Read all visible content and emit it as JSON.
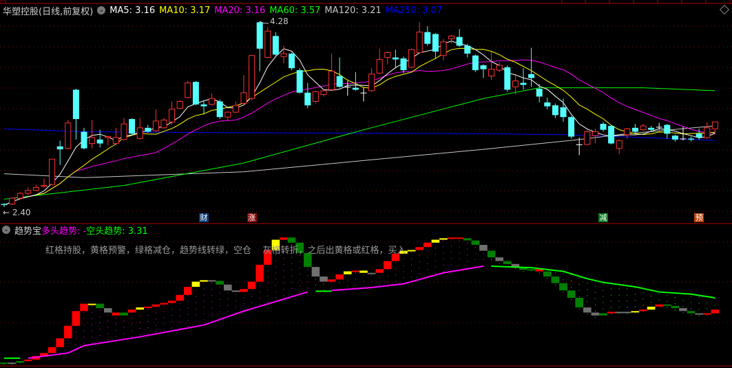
{
  "header": {
    "title": "华塑控股(日线,前复权)",
    "ma": [
      {
        "label": "MA5: 3.16",
        "color": "#ffffff"
      },
      {
        "label": "MA10: 3.17",
        "color": "#ffff00"
      },
      {
        "label": "MA20: 3.16",
        "color": "#ff00ff"
      },
      {
        "label": "MA60: 3.57",
        "color": "#00ff00"
      },
      {
        "label": "MA120: 3.21",
        "color": "#c8c8c8"
      },
      {
        "label": "MA250: 3.07",
        "color": "#0000ff"
      }
    ]
  },
  "indicator": {
    "name": "趋势宝",
    "bull_label": "多头趋势: -",
    "bear_label": "空头趋势: 3.31",
    "note": "红格持股，黄格预警，绿格减仓，趋势线转绿，空仓    灰格转折，之后出黄格或红格，买入"
  },
  "markers": [
    {
      "text": "财",
      "index": 25,
      "color": "#0a3d7a"
    },
    {
      "text": "涨",
      "index": 31,
      "color": "#8a0a0a"
    },
    {
      "text": "减",
      "index": 75,
      "color": "#0a7a1e"
    },
    {
      "text": "预",
      "index": 87,
      "color": "#b8420a"
    }
  ],
  "chart_data": [
    {
      "type": "candlestick",
      "ohlc": [
        [
          2.41,
          2.42,
          2.38,
          2.4
        ],
        [
          2.41,
          2.48,
          2.4,
          2.47
        ],
        [
          2.47,
          2.53,
          2.46,
          2.52
        ],
        [
          2.52,
          2.58,
          2.5,
          2.55
        ],
        [
          2.55,
          2.61,
          2.54,
          2.58
        ],
        [
          2.59,
          2.67,
          2.58,
          2.6
        ],
        [
          2.61,
          2.87,
          2.6,
          2.87
        ],
        [
          3.0,
          3.06,
          2.81,
          2.97
        ],
        [
          2.98,
          3.27,
          2.97,
          3.24
        ],
        [
          3.58,
          3.59,
          3.07,
          3.28
        ],
        [
          3.15,
          3.19,
          2.97,
          2.98
        ],
        [
          3.03,
          3.27,
          2.98,
          3.09
        ],
        [
          3.07,
          3.17,
          2.99,
          3.03
        ],
        [
          3.09,
          3.11,
          3.01,
          3.1
        ],
        [
          3.03,
          3.19,
          3.01,
          3.09
        ],
        [
          3.07,
          3.29,
          3.06,
          3.23
        ],
        [
          3.28,
          3.29,
          3.12,
          3.13
        ],
        [
          3.08,
          3.29,
          3.07,
          3.19
        ],
        [
          3.19,
          3.22,
          3.14,
          3.15
        ],
        [
          3.16,
          3.38,
          3.15,
          3.26
        ],
        [
          3.19,
          3.29,
          3.18,
          3.27
        ],
        [
          3.25,
          3.46,
          3.22,
          3.38
        ],
        [
          3.39,
          3.47,
          3.38,
          3.46
        ],
        [
          3.5,
          3.67,
          3.49,
          3.65
        ],
        [
          3.66,
          3.67,
          3.42,
          3.43
        ],
        [
          3.43,
          3.46,
          3.33,
          3.41
        ],
        [
          3.43,
          3.54,
          3.42,
          3.49
        ],
        [
          3.46,
          3.48,
          3.28,
          3.3
        ],
        [
          3.3,
          3.36,
          3.26,
          3.35
        ],
        [
          3.35,
          3.46,
          3.34,
          3.42
        ],
        [
          3.44,
          3.73,
          3.42,
          3.55
        ],
        [
          3.49,
          3.94,
          3.47,
          3.93
        ],
        [
          4.27,
          4.28,
          3.77,
          4.0
        ],
        [
          3.91,
          4.22,
          3.9,
          4.18
        ],
        [
          4.13,
          4.17,
          3.93,
          3.94
        ],
        [
          3.92,
          4.03,
          3.85,
          3.95
        ],
        [
          3.95,
          3.96,
          3.78,
          3.8
        ],
        [
          3.78,
          3.8,
          3.54,
          3.55
        ],
        [
          3.55,
          3.65,
          3.39,
          3.42
        ],
        [
          3.46,
          3.57,
          3.44,
          3.56
        ],
        [
          3.53,
          3.58,
          3.51,
          3.57
        ],
        [
          3.58,
          3.95,
          3.57,
          3.77
        ],
        [
          3.72,
          3.91,
          3.6,
          3.61
        ],
        [
          3.61,
          3.67,
          3.52,
          3.61
        ],
        [
          3.6,
          3.76,
          3.57,
          3.58
        ],
        [
          3.55,
          3.6,
          3.46,
          3.55
        ],
        [
          3.57,
          3.8,
          3.56,
          3.74
        ],
        [
          3.75,
          4.0,
          3.74,
          3.89
        ],
        [
          3.91,
          3.97,
          3.84,
          3.96
        ],
        [
          3.91,
          3.99,
          3.8,
          3.89
        ],
        [
          3.9,
          3.92,
          3.75,
          3.78
        ],
        [
          3.81,
          4.0,
          3.8,
          3.99
        ],
        [
          3.96,
          4.27,
          3.95,
          4.17
        ],
        [
          4.17,
          4.23,
          4.03,
          4.05
        ],
        [
          4.15,
          4.16,
          3.9,
          3.97
        ],
        [
          3.93,
          4.1,
          3.88,
          4.07
        ],
        [
          4.1,
          4.14,
          4.05,
          4.13
        ],
        [
          4.12,
          4.2,
          4.02,
          4.03
        ],
        [
          4.03,
          4.05,
          3.91,
          3.95
        ],
        [
          3.93,
          3.94,
          3.76,
          3.78
        ],
        [
          3.83,
          3.84,
          3.7,
          3.79
        ],
        [
          3.72,
          3.97,
          3.68,
          3.79
        ],
        [
          3.78,
          3.86,
          3.76,
          3.83
        ],
        [
          3.81,
          3.83,
          3.56,
          3.58
        ],
        [
          3.61,
          3.73,
          3.53,
          3.67
        ],
        [
          3.65,
          3.8,
          3.58,
          3.63
        ],
        [
          3.74,
          4.01,
          3.61,
          3.7
        ],
        [
          3.59,
          3.64,
          3.45,
          3.51
        ],
        [
          3.45,
          3.5,
          3.38,
          3.41
        ],
        [
          3.42,
          3.44,
          3.29,
          3.32
        ],
        [
          3.4,
          3.49,
          3.25,
          3.3
        ],
        [
          3.3,
          3.31,
          3.08,
          3.1
        ],
        [
          3.02,
          3.09,
          2.91,
          3.02
        ],
        [
          3.02,
          3.17,
          3.01,
          3.15
        ],
        [
          3.11,
          3.18,
          3.03,
          3.15
        ],
        [
          3.23,
          3.25,
          3.15,
          3.17
        ],
        [
          3.21,
          3.22,
          3.02,
          3.03
        ],
        [
          2.98,
          3.07,
          2.92,
          3.06
        ],
        [
          3.12,
          3.19,
          3.08,
          3.18
        ],
        [
          3.19,
          3.23,
          3.13,
          3.15
        ],
        [
          3.17,
          3.23,
          3.16,
          3.21
        ],
        [
          3.19,
          3.21,
          3.15,
          3.17
        ],
        [
          3.2,
          3.24,
          3.17,
          3.2
        ],
        [
          3.22,
          3.23,
          3.08,
          3.13
        ],
        [
          3.11,
          3.12,
          3.05,
          3.07
        ],
        [
          3.08,
          3.2,
          3.06,
          3.08
        ],
        [
          3.08,
          3.1,
          3.05,
          3.07
        ],
        [
          3.13,
          3.18,
          3.07,
          3.09
        ],
        [
          3.09,
          3.25,
          3.08,
          3.19
        ],
        [
          3.18,
          3.25,
          3.12,
          3.25
        ]
      ],
      "ylim": [
        2.4,
        4.28
      ],
      "high_label": "4.28",
      "low_label": "2.40",
      "long_ma": {
        "MA60": [
          [
            0,
            2.46
          ],
          [
            15,
            2.6
          ],
          [
            30,
            2.83
          ],
          [
            45,
            3.17
          ],
          [
            60,
            3.49
          ],
          [
            67,
            3.6
          ],
          [
            80,
            3.6
          ],
          [
            89,
            3.57
          ]
        ],
        "MA120": [
          [
            0,
            2.72
          ],
          [
            10,
            2.68
          ],
          [
            30,
            2.74
          ],
          [
            60,
            2.97
          ],
          [
            72,
            3.07
          ],
          [
            78,
            3.13
          ],
          [
            89,
            3.21
          ]
        ],
        "MA250": [
          [
            0,
            3.18
          ],
          [
            10,
            3.15
          ],
          [
            30,
            3.14
          ],
          [
            60,
            3.13
          ],
          [
            70,
            3.12
          ],
          [
            80,
            3.09
          ],
          [
            89,
            3.06
          ]
        ]
      },
      "colors": {
        "up": "#ff3232",
        "down": "#54ffff",
        "doji": "#ffffff"
      }
    },
    {
      "type": "step-blocks",
      "levels": [
        2.43,
        2.43,
        2.45,
        2.47,
        2.52,
        2.56,
        2.64,
        2.76,
        2.93,
        3.13,
        3.23,
        3.23,
        3.17,
        3.11,
        3.07,
        3.11,
        3.15,
        3.18,
        3.19,
        3.22,
        3.24,
        3.27,
        3.35,
        3.46,
        3.53,
        3.55,
        3.54,
        3.49,
        3.41,
        3.39,
        3.43,
        3.53,
        3.76,
        3.96,
        4.1,
        4.13,
        4.06,
        3.92,
        3.73,
        3.6,
        3.53,
        3.56,
        3.63,
        3.67,
        3.68,
        3.65,
        3.65,
        3.7,
        3.81,
        3.91,
        3.95,
        3.96,
        4.0,
        4.06,
        4.1,
        4.12,
        4.13,
        4.12,
        4.09,
        4.03,
        3.95,
        3.86,
        3.81,
        3.77,
        3.73,
        3.69,
        3.7,
        3.67,
        3.6,
        3.51,
        3.41,
        3.31,
        3.18,
        3.11,
        3.07,
        3.1,
        3.12,
        3.12,
        3.12,
        3.13,
        3.15,
        3.19,
        3.22,
        3.2,
        3.17,
        3.13,
        3.1,
        3.09,
        3.1,
        3.15
      ],
      "colors_seq": "grgrrrrrrrryggrgryrrrrrryyggggrrrryrgggggrryrygrrryyrryyrrgggggggggrggggggggrygyryrggggrr",
      "block_colors": {
        "r": "#ff0000",
        "y": "#ffff00",
        "g": "#008000",
        "a": "#707070"
      },
      "gray_index": [
        1,
        13,
        26,
        28,
        29,
        39,
        40,
        46,
        60,
        62,
        64,
        73,
        74,
        77,
        78,
        85,
        87
      ],
      "bull_trend": [
        [
          [
            3,
            2.49
          ],
          [
            8,
            2.56
          ],
          [
            10,
            2.66
          ],
          [
            17,
            2.78
          ],
          [
            25,
            2.94
          ],
          [
            30,
            3.13
          ],
          [
            38,
            3.39
          ]
        ],
        [
          [
            41,
            3.41
          ],
          [
            46,
            3.45
          ],
          [
            50,
            3.5
          ],
          [
            55,
            3.65
          ],
          [
            60,
            3.74
          ]
        ]
      ],
      "bear_trend": [
        [
          [
            0,
            2.49
          ],
          [
            2,
            2.49
          ]
        ],
        [
          [
            39,
            3.4
          ],
          [
            41,
            3.4
          ]
        ],
        [
          [
            61,
            3.74
          ],
          [
            66,
            3.72
          ],
          [
            70,
            3.67
          ],
          [
            73,
            3.57
          ],
          [
            75,
            3.52
          ],
          [
            79,
            3.46
          ],
          [
            82,
            3.39
          ],
          [
            86,
            3.36
          ],
          [
            89,
            3.31
          ]
        ]
      ],
      "bull_color": "#ff00ff",
      "bear_color": "#00ff00"
    }
  ]
}
